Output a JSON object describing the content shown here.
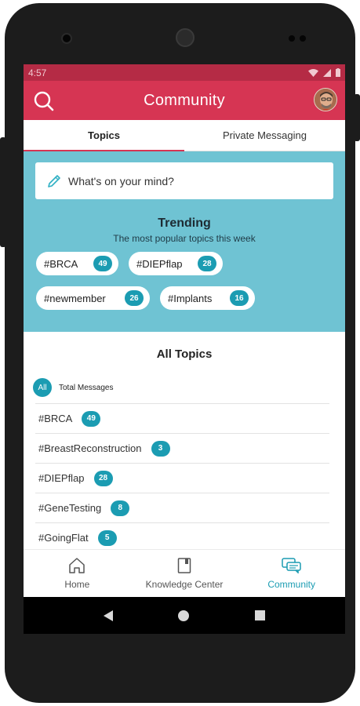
{
  "status": {
    "time": "4:57"
  },
  "appbar": {
    "title": "Community",
    "search_icon": "search-icon",
    "avatar_icon": "user-avatar"
  },
  "tabs": [
    {
      "label": "Topics",
      "active": true
    },
    {
      "label": "Private Messaging",
      "active": false
    }
  ],
  "compose": {
    "placeholder": "What's on your mind?"
  },
  "trending": {
    "title": "Trending",
    "subtitle": "The most popular topics this week",
    "chips": [
      {
        "tag": "#BRCA",
        "count": "49"
      },
      {
        "tag": "#DIEPflap",
        "count": "28"
      },
      {
        "tag": "#newmember",
        "count": "26"
      },
      {
        "tag": "#Implants",
        "count": "16"
      }
    ]
  },
  "all_topics": {
    "title": "All Topics",
    "filter_label": "All",
    "total_label": "Total Messages",
    "items": [
      {
        "tag": "#BRCA",
        "count": "49"
      },
      {
        "tag": "#BreastReconstruction",
        "count": "3"
      },
      {
        "tag": "#DIEPflap",
        "count": "28"
      },
      {
        "tag": "#GeneTesting",
        "count": "8"
      },
      {
        "tag": "#GoingFlat",
        "count": "5"
      }
    ]
  },
  "bottom_nav": [
    {
      "label": "Home",
      "icon": "home-icon",
      "active": false
    },
    {
      "label": "Knowledge Center",
      "icon": "book-icon",
      "active": false
    },
    {
      "label": "Community",
      "icon": "chat-icon",
      "active": true
    }
  ],
  "colors": {
    "primary": "#d63553",
    "status_bar": "#b52b45",
    "accent": "#1b9cb2",
    "trending_bg": "#6fc3d3"
  }
}
